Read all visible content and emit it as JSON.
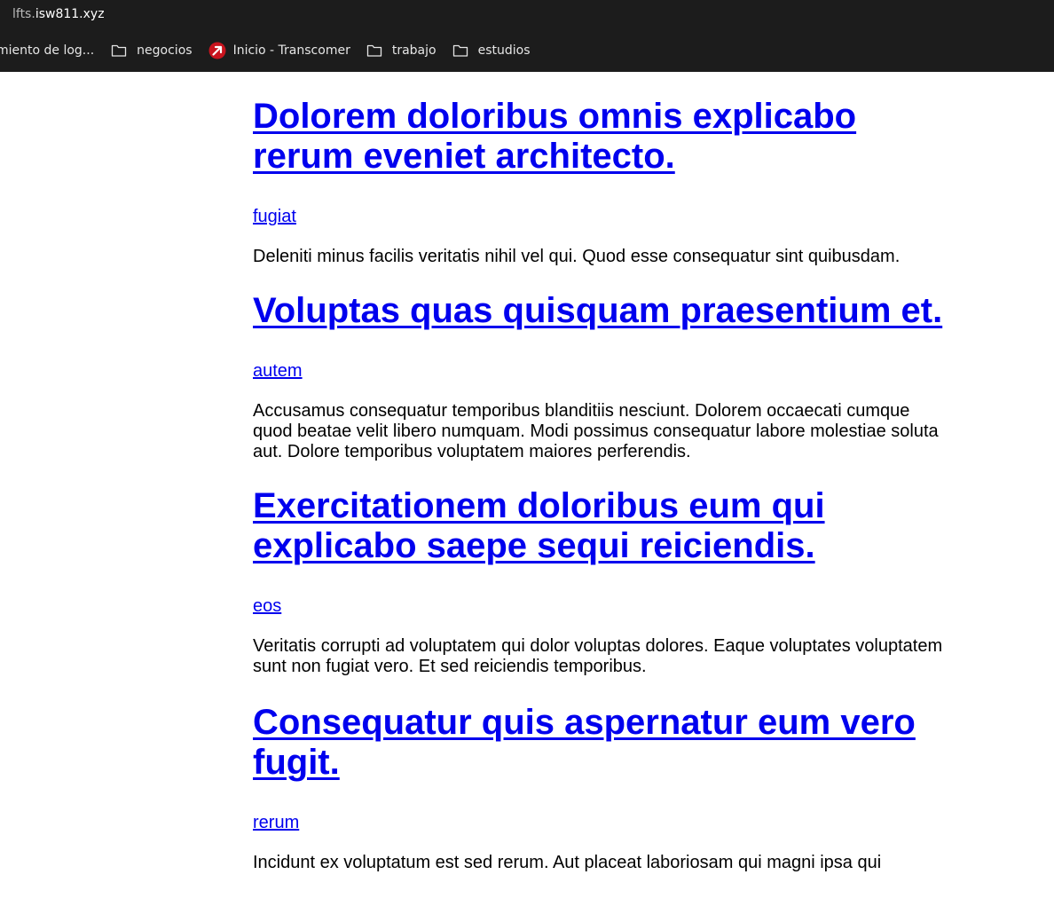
{
  "browser": {
    "url_prefix": "lfts.",
    "url_domain": "isw811.xyz",
    "bookmarks": [
      {
        "label": "miento de log...",
        "icon": "folder-icon"
      },
      {
        "label": "negocios",
        "icon": "folder-icon"
      },
      {
        "label": "Inicio - Transcomer",
        "icon": "transcomer-favicon-icon"
      },
      {
        "label": "trabajo",
        "icon": "folder-icon"
      },
      {
        "label": "estudios",
        "icon": "folder-icon"
      }
    ]
  },
  "posts": [
    {
      "title": "Dolorem doloribus omnis explicabo rerum eveniet architecto.",
      "tag": "fugiat",
      "excerpt": "Deleniti minus facilis veritatis nihil vel qui. Quod esse consequatur sint quibusdam."
    },
    {
      "title": "Voluptas quas quisquam praesentium et.",
      "tag": "autem",
      "excerpt": "Accusamus consequatur temporibus blanditiis nesciunt. Dolorem occaecati cumque quod beatae velit libero numquam. Modi possimus consequatur labore molestiae soluta aut. Dolore temporibus voluptatem maiores perferendis."
    },
    {
      "title": "Exercitationem doloribus eum qui explicabo saepe sequi reiciendis.",
      "tag": "eos",
      "excerpt": "Veritatis corrupti ad voluptatem qui dolor voluptas dolores. Eaque voluptates voluptatem sunt non fugiat vero. Et sed reiciendis temporibus."
    },
    {
      "title": "Consequatur quis aspernatur eum vero fugit.",
      "tag": "rerum",
      "excerpt": "Incidunt ex voluptatum est sed rerum. Aut placeat laboriosam qui magni ipsa qui"
    }
  ],
  "colors": {
    "chrome_bg": "#1c1c1c",
    "link": "#0000ee",
    "transcomer_icon": "#c8141e"
  }
}
